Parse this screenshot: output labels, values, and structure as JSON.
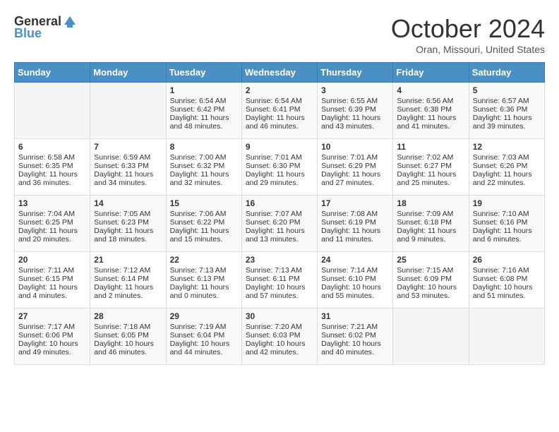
{
  "logo": {
    "general": "General",
    "blue": "Blue"
  },
  "title": "October 2024",
  "location": "Oran, Missouri, United States",
  "weekdays": [
    "Sunday",
    "Monday",
    "Tuesday",
    "Wednesday",
    "Thursday",
    "Friday",
    "Saturday"
  ],
  "weeks": [
    [
      {
        "day": "",
        "sunrise": "",
        "sunset": "",
        "daylight": ""
      },
      {
        "day": "",
        "sunrise": "",
        "sunset": "",
        "daylight": ""
      },
      {
        "day": "1",
        "sunrise": "Sunrise: 6:54 AM",
        "sunset": "Sunset: 6:42 PM",
        "daylight": "Daylight: 11 hours and 48 minutes."
      },
      {
        "day": "2",
        "sunrise": "Sunrise: 6:54 AM",
        "sunset": "Sunset: 6:41 PM",
        "daylight": "Daylight: 11 hours and 46 minutes."
      },
      {
        "day": "3",
        "sunrise": "Sunrise: 6:55 AM",
        "sunset": "Sunset: 6:39 PM",
        "daylight": "Daylight: 11 hours and 43 minutes."
      },
      {
        "day": "4",
        "sunrise": "Sunrise: 6:56 AM",
        "sunset": "Sunset: 6:38 PM",
        "daylight": "Daylight: 11 hours and 41 minutes."
      },
      {
        "day": "5",
        "sunrise": "Sunrise: 6:57 AM",
        "sunset": "Sunset: 6:36 PM",
        "daylight": "Daylight: 11 hours and 39 minutes."
      }
    ],
    [
      {
        "day": "6",
        "sunrise": "Sunrise: 6:58 AM",
        "sunset": "Sunset: 6:35 PM",
        "daylight": "Daylight: 11 hours and 36 minutes."
      },
      {
        "day": "7",
        "sunrise": "Sunrise: 6:59 AM",
        "sunset": "Sunset: 6:33 PM",
        "daylight": "Daylight: 11 hours and 34 minutes."
      },
      {
        "day": "8",
        "sunrise": "Sunrise: 7:00 AM",
        "sunset": "Sunset: 6:32 PM",
        "daylight": "Daylight: 11 hours and 32 minutes."
      },
      {
        "day": "9",
        "sunrise": "Sunrise: 7:01 AM",
        "sunset": "Sunset: 6:30 PM",
        "daylight": "Daylight: 11 hours and 29 minutes."
      },
      {
        "day": "10",
        "sunrise": "Sunrise: 7:01 AM",
        "sunset": "Sunset: 6:29 PM",
        "daylight": "Daylight: 11 hours and 27 minutes."
      },
      {
        "day": "11",
        "sunrise": "Sunrise: 7:02 AM",
        "sunset": "Sunset: 6:27 PM",
        "daylight": "Daylight: 11 hours and 25 minutes."
      },
      {
        "day": "12",
        "sunrise": "Sunrise: 7:03 AM",
        "sunset": "Sunset: 6:26 PM",
        "daylight": "Daylight: 11 hours and 22 minutes."
      }
    ],
    [
      {
        "day": "13",
        "sunrise": "Sunrise: 7:04 AM",
        "sunset": "Sunset: 6:25 PM",
        "daylight": "Daylight: 11 hours and 20 minutes."
      },
      {
        "day": "14",
        "sunrise": "Sunrise: 7:05 AM",
        "sunset": "Sunset: 6:23 PM",
        "daylight": "Daylight: 11 hours and 18 minutes."
      },
      {
        "day": "15",
        "sunrise": "Sunrise: 7:06 AM",
        "sunset": "Sunset: 6:22 PM",
        "daylight": "Daylight: 11 hours and 15 minutes."
      },
      {
        "day": "16",
        "sunrise": "Sunrise: 7:07 AM",
        "sunset": "Sunset: 6:20 PM",
        "daylight": "Daylight: 11 hours and 13 minutes."
      },
      {
        "day": "17",
        "sunrise": "Sunrise: 7:08 AM",
        "sunset": "Sunset: 6:19 PM",
        "daylight": "Daylight: 11 hours and 11 minutes."
      },
      {
        "day": "18",
        "sunrise": "Sunrise: 7:09 AM",
        "sunset": "Sunset: 6:18 PM",
        "daylight": "Daylight: 11 hours and 9 minutes."
      },
      {
        "day": "19",
        "sunrise": "Sunrise: 7:10 AM",
        "sunset": "Sunset: 6:16 PM",
        "daylight": "Daylight: 11 hours and 6 minutes."
      }
    ],
    [
      {
        "day": "20",
        "sunrise": "Sunrise: 7:11 AM",
        "sunset": "Sunset: 6:15 PM",
        "daylight": "Daylight: 11 hours and 4 minutes."
      },
      {
        "day": "21",
        "sunrise": "Sunrise: 7:12 AM",
        "sunset": "Sunset: 6:14 PM",
        "daylight": "Daylight: 11 hours and 2 minutes."
      },
      {
        "day": "22",
        "sunrise": "Sunrise: 7:13 AM",
        "sunset": "Sunset: 6:13 PM",
        "daylight": "Daylight: 11 hours and 0 minutes."
      },
      {
        "day": "23",
        "sunrise": "Sunrise: 7:13 AM",
        "sunset": "Sunset: 6:11 PM",
        "daylight": "Daylight: 10 hours and 57 minutes."
      },
      {
        "day": "24",
        "sunrise": "Sunrise: 7:14 AM",
        "sunset": "Sunset: 6:10 PM",
        "daylight": "Daylight: 10 hours and 55 minutes."
      },
      {
        "day": "25",
        "sunrise": "Sunrise: 7:15 AM",
        "sunset": "Sunset: 6:09 PM",
        "daylight": "Daylight: 10 hours and 53 minutes."
      },
      {
        "day": "26",
        "sunrise": "Sunrise: 7:16 AM",
        "sunset": "Sunset: 6:08 PM",
        "daylight": "Daylight: 10 hours and 51 minutes."
      }
    ],
    [
      {
        "day": "27",
        "sunrise": "Sunrise: 7:17 AM",
        "sunset": "Sunset: 6:06 PM",
        "daylight": "Daylight: 10 hours and 49 minutes."
      },
      {
        "day": "28",
        "sunrise": "Sunrise: 7:18 AM",
        "sunset": "Sunset: 6:05 PM",
        "daylight": "Daylight: 10 hours and 46 minutes."
      },
      {
        "day": "29",
        "sunrise": "Sunrise: 7:19 AM",
        "sunset": "Sunset: 6:04 PM",
        "daylight": "Daylight: 10 hours and 44 minutes."
      },
      {
        "day": "30",
        "sunrise": "Sunrise: 7:20 AM",
        "sunset": "Sunset: 6:03 PM",
        "daylight": "Daylight: 10 hours and 42 minutes."
      },
      {
        "day": "31",
        "sunrise": "Sunrise: 7:21 AM",
        "sunset": "Sunset: 6:02 PM",
        "daylight": "Daylight: 10 hours and 40 minutes."
      },
      {
        "day": "",
        "sunrise": "",
        "sunset": "",
        "daylight": ""
      },
      {
        "day": "",
        "sunrise": "",
        "sunset": "",
        "daylight": ""
      }
    ]
  ]
}
